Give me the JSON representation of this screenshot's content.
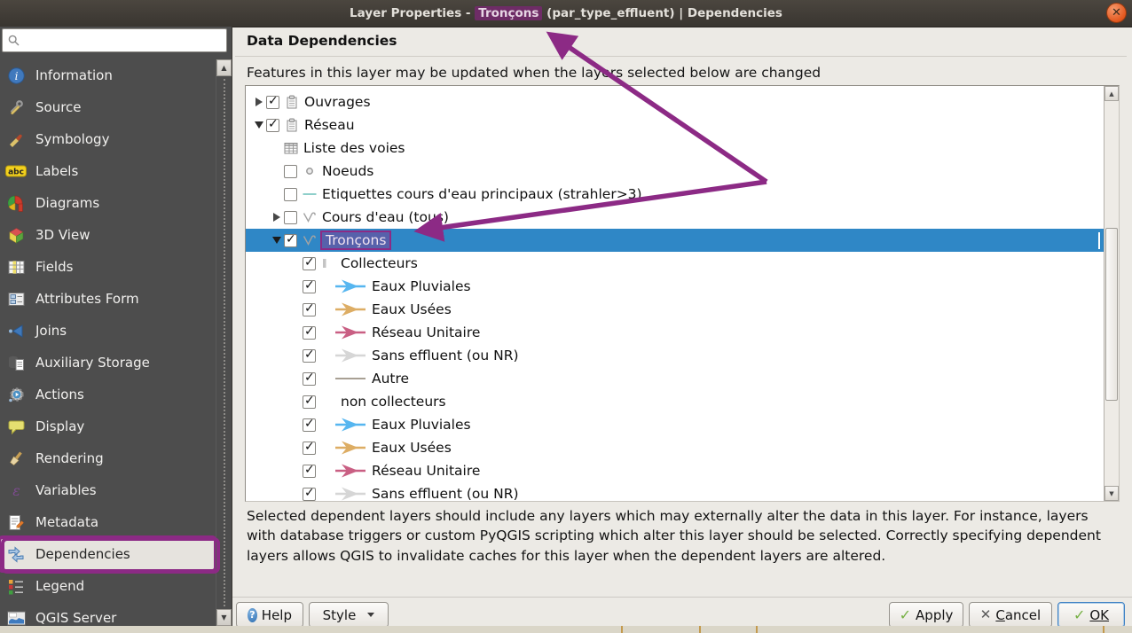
{
  "titlebar": {
    "prefix": "Layer Properties - ",
    "highlight": "Tronçons",
    "suffix": " (par_type_effluent) | Dependencies",
    "close_glyph": "✕"
  },
  "sidebar": {
    "search_placeholder": "",
    "selected": "Dependencies",
    "items": [
      {
        "label": "Information",
        "icon": "info-icon"
      },
      {
        "label": "Source",
        "icon": "source-icon"
      },
      {
        "label": "Symbology",
        "icon": "symbology-icon"
      },
      {
        "label": "Labels",
        "icon": "labels-icon"
      },
      {
        "label": "Diagrams",
        "icon": "diagrams-icon"
      },
      {
        "label": "3D View",
        "icon": "three-d-view-icon"
      },
      {
        "label": "Fields",
        "icon": "fields-icon"
      },
      {
        "label": "Attributes Form",
        "icon": "attributes-form-icon"
      },
      {
        "label": "Joins",
        "icon": "joins-icon"
      },
      {
        "label": "Auxiliary Storage",
        "icon": "auxiliary-storage-icon"
      },
      {
        "label": "Actions",
        "icon": "actions-icon"
      },
      {
        "label": "Display",
        "icon": "display-icon"
      },
      {
        "label": "Rendering",
        "icon": "rendering-icon"
      },
      {
        "label": "Variables",
        "icon": "variables-icon"
      },
      {
        "label": "Metadata",
        "icon": "metadata-icon"
      },
      {
        "label": "Dependencies",
        "icon": "dependencies-icon"
      },
      {
        "label": "Legend",
        "icon": "legend-icon"
      },
      {
        "label": "QGIS Server",
        "icon": "qgis-server-icon"
      }
    ]
  },
  "content": {
    "heading": "Data Dependencies",
    "intro": "Features in this layer may be updated when the layers selected below are changed",
    "note": "Selected dependent layers should include any layers which may externally alter the data in this layer. For instance, layers with database triggers or custom PyQGIS scripting which alter this layer should be selected. Correctly specifying dependent layers allows QGIS to invalidate caches for this layer when the dependent layers are altered."
  },
  "tree": {
    "rows": [
      {
        "level": 1,
        "expand": "collapsed",
        "checked": true,
        "icon": "group-icon",
        "label": "Ouvrages"
      },
      {
        "level": 1,
        "expand": "expanded",
        "checked": true,
        "icon": "group-icon",
        "label": "Réseau"
      },
      {
        "level": 2,
        "expand": null,
        "checked": null,
        "icon": "table-layer-icon",
        "label": "Liste des voies"
      },
      {
        "level": 2,
        "expand": null,
        "checked": false,
        "icon": "point-layer-icon",
        "label": "Noeuds"
      },
      {
        "level": 2,
        "expand": null,
        "checked": false,
        "icon": "teal-line-icon",
        "label": "Etiquettes cours d'eau principaux (strahler>3)"
      },
      {
        "level": 2,
        "expand": "collapsed",
        "checked": false,
        "icon": "polyline-layer-icon",
        "label": "Cours d'eau (tous)"
      },
      {
        "level": 2,
        "expand": "expanded",
        "checked": true,
        "icon": "polyline-layer-icon",
        "label": "Tronçons",
        "selected": true,
        "annotated": true
      },
      {
        "level": 3,
        "expand": null,
        "checked": true,
        "icon": "rule-bar-icon",
        "label": "Collecteurs"
      },
      {
        "level": 4,
        "expand": null,
        "checked": true,
        "icon": "arrow-symbol-blue-icon",
        "label": "Eaux Pluviales"
      },
      {
        "level": 4,
        "expand": null,
        "checked": true,
        "icon": "arrow-symbol-tan-icon",
        "label": "Eaux Usées"
      },
      {
        "level": 4,
        "expand": null,
        "checked": true,
        "icon": "arrow-symbol-pink-icon",
        "label": "Réseau Unitaire"
      },
      {
        "level": 4,
        "expand": null,
        "checked": true,
        "icon": "arrow-symbol-gray-icon",
        "label": "Sans effluent (ou NR)"
      },
      {
        "level": 4,
        "expand": null,
        "checked": true,
        "icon": "plain-line-icon",
        "label": "Autre"
      },
      {
        "level": 3,
        "expand": null,
        "checked": true,
        "icon": null,
        "label": "non collecteurs"
      },
      {
        "level": 4,
        "expand": null,
        "checked": true,
        "icon": "arrow-symbol-blue-icon",
        "label": "Eaux Pluviales"
      },
      {
        "level": 4,
        "expand": null,
        "checked": true,
        "icon": "arrow-symbol-tan-icon",
        "label": "Eaux Usées"
      },
      {
        "level": 4,
        "expand": null,
        "checked": true,
        "icon": "arrow-symbol-pink-icon",
        "label": "Réseau Unitaire"
      },
      {
        "level": 4,
        "expand": null,
        "checked": true,
        "icon": "arrow-symbol-gray-icon",
        "label": "Sans effluent (ou NR)"
      }
    ]
  },
  "buttons": {
    "help": "Help",
    "style": "Style",
    "apply": "Apply",
    "cancel": "Cancel",
    "cancel_prefix": "C",
    "cancel_rest": "ancel",
    "ok": "OK"
  },
  "annotation": {
    "color": "#8c2a85",
    "title_highlighted_term": "Tronçons",
    "boxed_sidebar_item": "Dependencies",
    "boxed_tree_item": "Tronçons"
  },
  "colors": {
    "selection_blue": "#2f87c6",
    "annotation_purple": "#8c2a85",
    "titlebar_dark": "#3e3a33",
    "sidebar_gray": "#4d4d4d",
    "symbol_blue": "#56b6f0",
    "symbol_tan": "#ddad64",
    "symbol_pink": "#c95f83",
    "symbol_gray": "#d6d6d6"
  }
}
